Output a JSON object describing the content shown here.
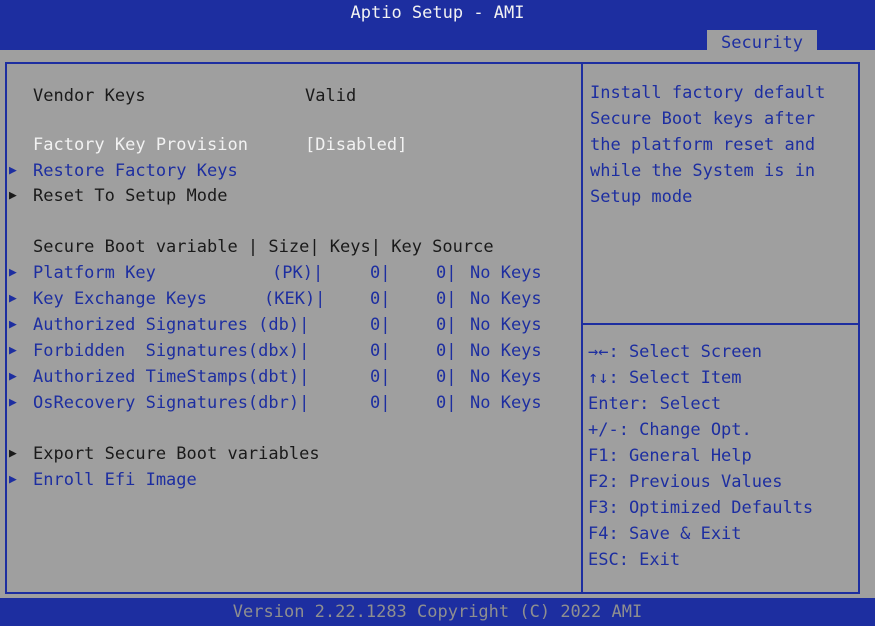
{
  "header": {
    "title": "Aptio Setup - AMI",
    "active_tab": "Security"
  },
  "main": {
    "vendor_keys_label": "Vendor Keys",
    "vendor_keys_value": "Valid",
    "factory_key_label": "Factory Key Provision",
    "factory_key_value": "[Disabled]",
    "restore_label": "Restore Factory Keys",
    "reset_label": "Reset To Setup Mode",
    "table_header": "Secure Boot variable | Size| Keys| Key Source",
    "rows": [
      {
        "name": "Platform Key",
        "abbr": "(PK)|",
        "size": "0|",
        "keys": "0|",
        "source": "No Keys"
      },
      {
        "name": "Key Exchange Keys",
        "abbr": "(KEK)|",
        "size": "0|",
        "keys": "0|",
        "source": "No Keys"
      },
      {
        "name": "Authorized Signatures (db)|",
        "abbr": "",
        "size": "0|",
        "keys": "0|",
        "source": "No Keys"
      },
      {
        "name": "Forbidden  Signatures(dbx)|",
        "abbr": "",
        "size": "0|",
        "keys": "0|",
        "source": "No Keys"
      },
      {
        "name": "Authorized TimeStamps(dbt)|",
        "abbr": "",
        "size": "0|",
        "keys": "0|",
        "source": "No Keys"
      },
      {
        "name": "OsRecovery Signatures(dbr)|",
        "abbr": "",
        "size": "0|",
        "keys": "0|",
        "source": "No Keys"
      }
    ],
    "export_label": "Export Secure Boot variables",
    "enroll_label": "Enroll Efi Image"
  },
  "help": {
    "lines": [
      "Install factory default",
      "Secure Boot keys after",
      "the platform reset and",
      "while the System is in",
      "Setup mode"
    ]
  },
  "keys_help": {
    "lines": [
      "→←: Select Screen",
      "↑↓: Select Item",
      "Enter: Select",
      "+/-: Change Opt.",
      "F1: General Help",
      "F2: Previous Values",
      "F3: Optimized Defaults",
      "F4: Save & Exit",
      "ESC: Exit"
    ]
  },
  "footer": {
    "version": "Version 2.22.1283 Copyright (C) 2022 AMI"
  },
  "colors": {
    "accent_blue": "#1d2ea0",
    "background_gray": "#9f9f9f",
    "highlight_white": "#f2f2f2"
  }
}
